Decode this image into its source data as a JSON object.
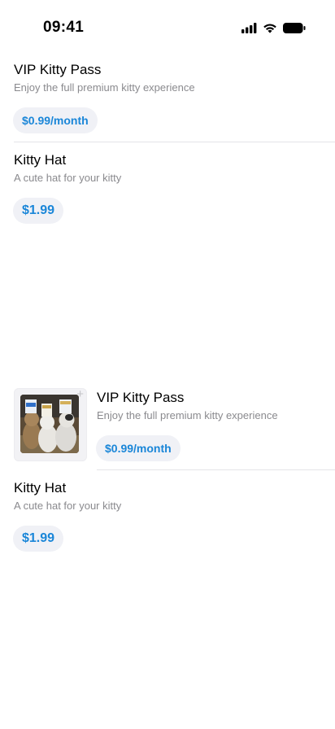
{
  "status_bar": {
    "time": "09:41"
  },
  "top_list": {
    "items": [
      {
        "title": "VIP Kitty Pass",
        "description": "Enjoy the full premium kitty experience",
        "price": "$0.99/month"
      },
      {
        "title": "Kitty Hat",
        "description": "A cute hat for your kitty",
        "price": "$1.99"
      }
    ]
  },
  "bottom_list": {
    "items": [
      {
        "title": "VIP Kitty Pass",
        "description": "Enjoy the full premium kitty experience",
        "price": "$0.99/month",
        "image_icon": "add-icon",
        "image_icon_glyph": "+"
      },
      {
        "title": "Kitty Hat",
        "description": "A cute hat for your kitty",
        "price": "$1.99"
      }
    ]
  },
  "colors": {
    "accent": "#1a86d8",
    "pill_background": "#f0f1f6",
    "secondary_text": "#8a8a8e",
    "divider": "#e4e4e8"
  },
  "icons": [
    "cellular-signal-icon",
    "wifi-icon",
    "battery-icon",
    "add-icon"
  ]
}
